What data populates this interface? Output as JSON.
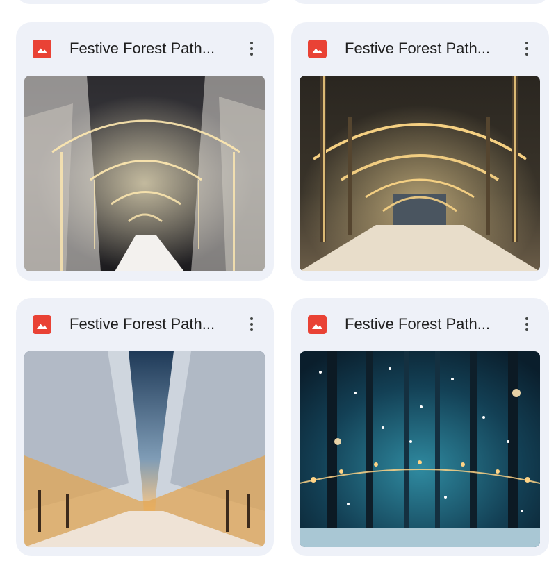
{
  "files": [
    {
      "title": "Festive Forest Path...",
      "icon": "image-file-icon",
      "menu_icon": "more-vert-icon"
    },
    {
      "title": "Festive Forest Path...",
      "icon": "image-file-icon",
      "menu_icon": "more-vert-icon"
    },
    {
      "title": "Festive Forest Path...",
      "icon": "image-file-icon",
      "menu_icon": "more-vert-icon"
    },
    {
      "title": "Festive Forest Path...",
      "icon": "image-file-icon",
      "menu_icon": "more-vert-icon"
    }
  ],
  "colors": {
    "card_background": "#eef1f8",
    "image_icon": "#e94235",
    "title_text": "#1f1f1f",
    "menu_dots": "#444746"
  }
}
